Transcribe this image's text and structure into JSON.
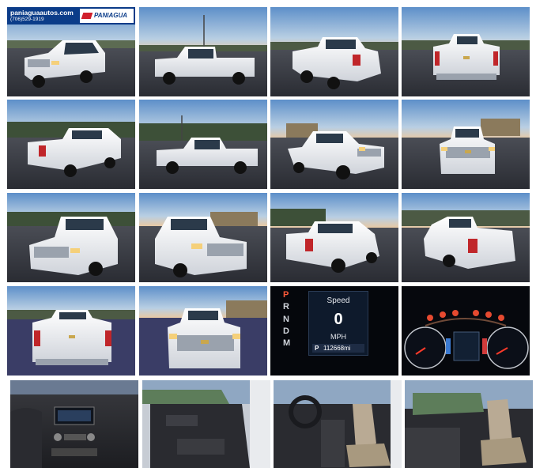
{
  "banner": {
    "site": "paniaguaautos.com",
    "phone": "(706)529-1919",
    "brand": "PANIAGUA"
  },
  "dash": {
    "prnd": [
      "P",
      "R",
      "N",
      "D",
      "M"
    ],
    "speed_label": "Speed",
    "speed_value": "0",
    "speed_unit": "MPH",
    "odometer": "112668mi",
    "gear_indicator": "P"
  },
  "photos": [
    "front-left-view",
    "side-view-left",
    "rear-left-view",
    "rear-view",
    "rear-left-view-2",
    "side-view-left-2",
    "front-right-view",
    "front-view",
    "front-left-close",
    "front-right-close",
    "rear-right-view",
    "rear-right-view-2",
    "rear-close",
    "front-close",
    "speedometer-closeup",
    "instrument-cluster",
    "center-console-radio",
    "driver-door-panel",
    "driver-seat-interior",
    "passenger-seat-interior"
  ]
}
